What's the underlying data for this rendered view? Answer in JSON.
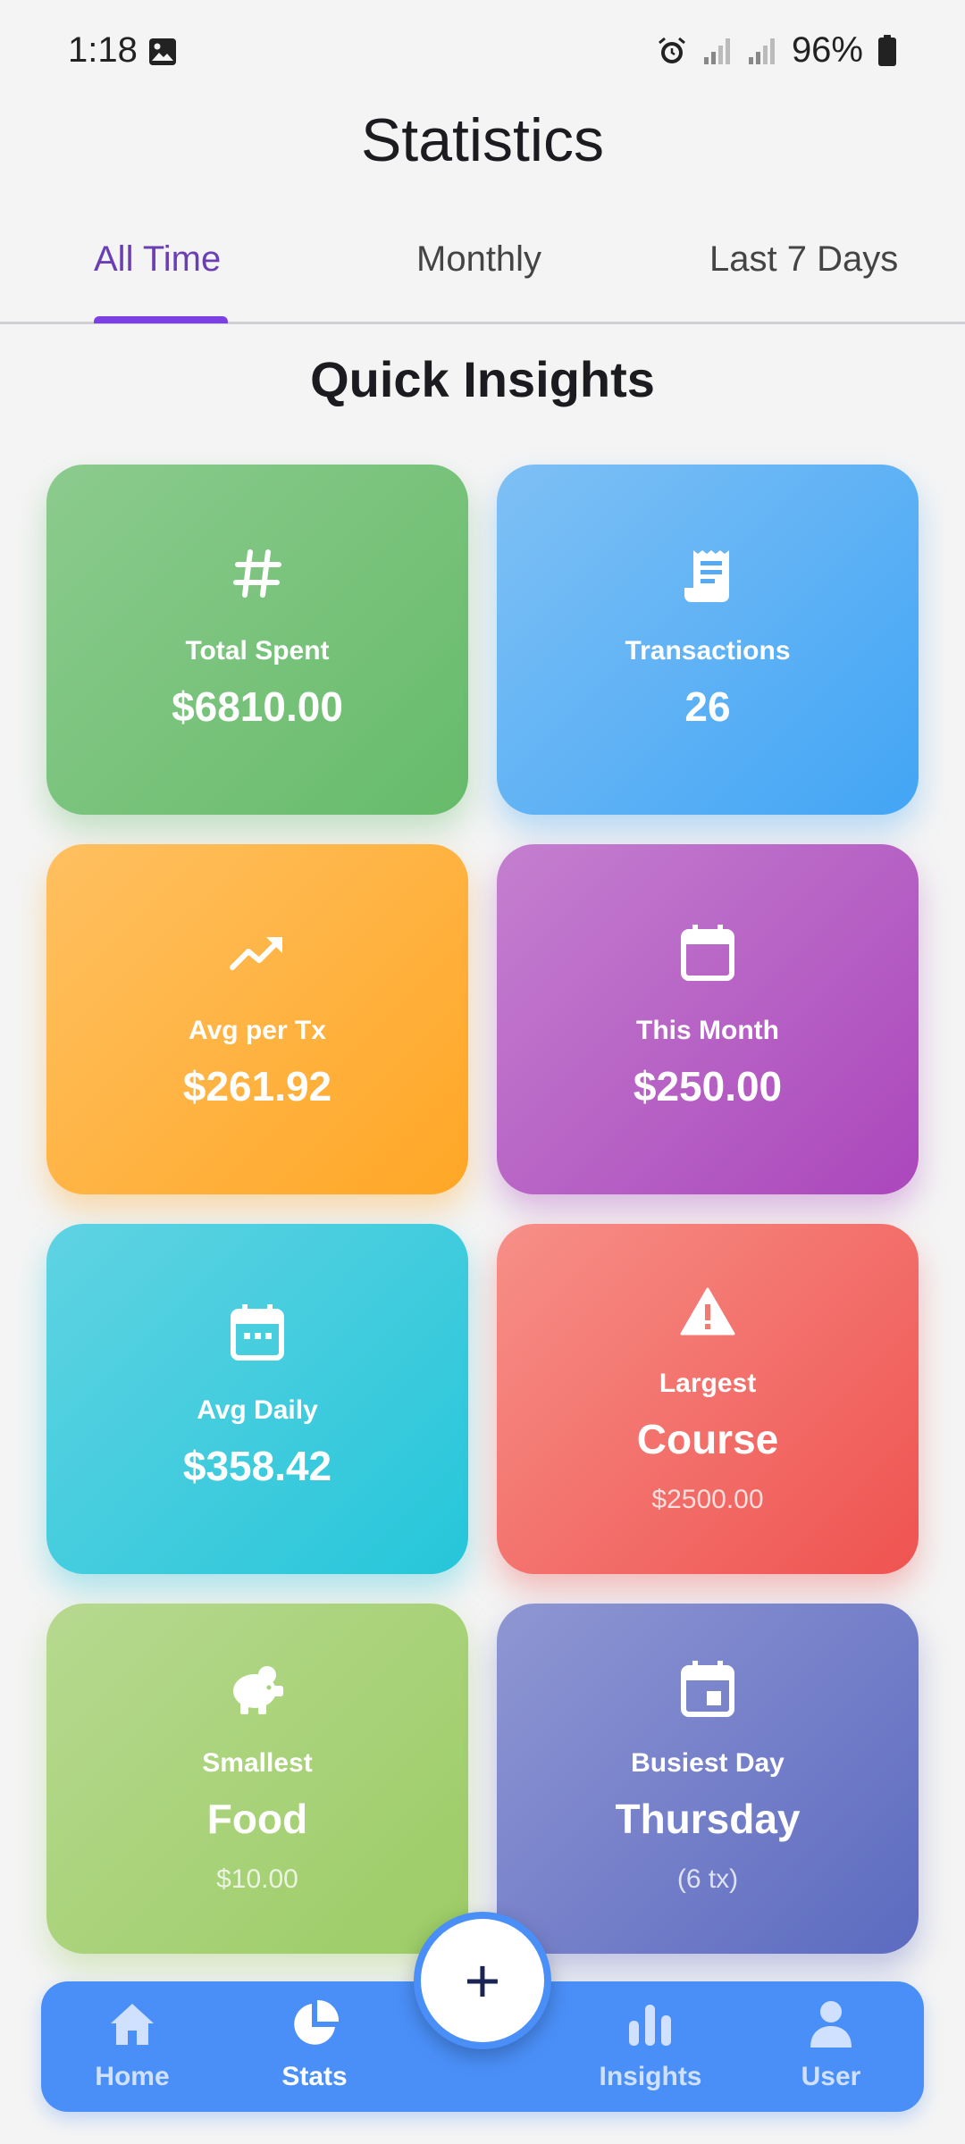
{
  "status_bar": {
    "time": "1:18",
    "battery": "96%"
  },
  "header": {
    "title": "Statistics"
  },
  "tabs": [
    {
      "label": "All Time",
      "active": true
    },
    {
      "label": "Monthly",
      "active": false
    },
    {
      "label": "Last 7 Days",
      "active": false
    }
  ],
  "section_title": "Quick Insights",
  "cards": [
    {
      "icon": "hash-icon",
      "label": "Total Spent",
      "value": "$6810.00",
      "color": "#66bb6a"
    },
    {
      "icon": "receipt-icon",
      "label": "Transactions",
      "value": "26",
      "color": "#42a5f5"
    },
    {
      "icon": "trending-up-icon",
      "label": "Avg per Tx",
      "value": "$261.92",
      "color": "#ffa726"
    },
    {
      "icon": "calendar-icon",
      "label": "This Month",
      "value": "$250.00",
      "color": "#ab47bc"
    },
    {
      "icon": "calendar-dots-icon",
      "label": "Avg Daily",
      "value": "$358.42",
      "color": "#26c6da"
    },
    {
      "icon": "warning-icon",
      "label": "Largest",
      "value": "Course",
      "sub": "$2500.00",
      "color": "#ef5350"
    },
    {
      "icon": "piggy-bank-icon",
      "label": "Smallest",
      "value": "Food",
      "sub": "$10.00",
      "color": "#9ccc65"
    },
    {
      "icon": "calendar-event-icon",
      "label": "Busiest Day",
      "value": "Thursday",
      "sub": "(6 tx)",
      "color": "#5c6bc0"
    }
  ],
  "nav": {
    "items": [
      {
        "label": "Home",
        "icon": "home-icon",
        "active": false
      },
      {
        "label": "Stats",
        "icon": "pie-chart-icon",
        "active": true
      },
      {
        "label": "Insights",
        "icon": "bar-chart-icon",
        "active": false
      },
      {
        "label": "User",
        "icon": "user-icon",
        "active": false
      }
    ],
    "fab_symbol": "+"
  },
  "colors": {
    "accent": "#7b3fe4",
    "nav_bg": "#4a8ff8"
  }
}
